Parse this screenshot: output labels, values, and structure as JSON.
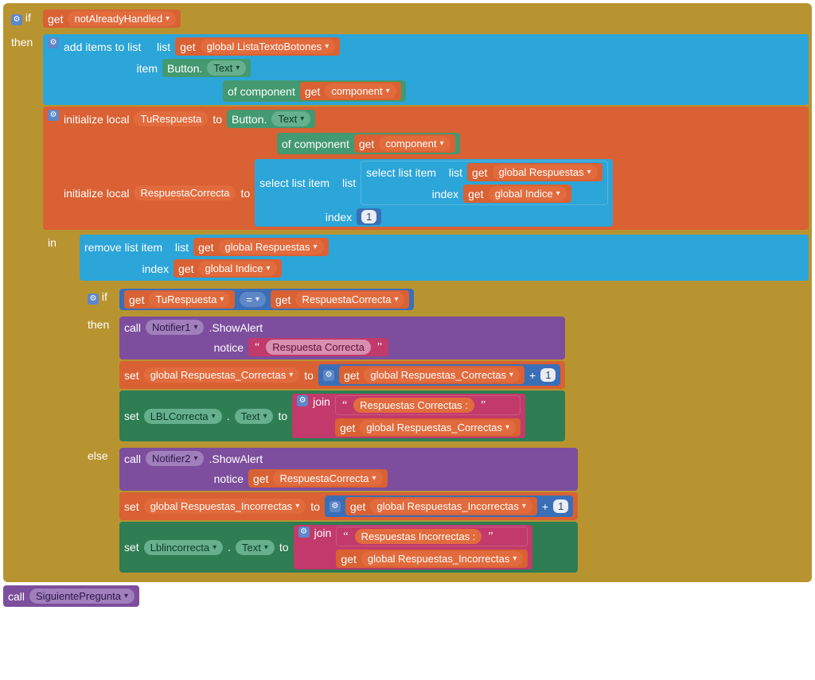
{
  "kw": {
    "if": "if",
    "then": "then",
    "else": "else",
    "in": "in",
    "get": "get",
    "set": "set",
    "to": "to",
    "call": "call",
    "join": "join",
    "addItems": "add items to list",
    "list": "list",
    "item": "item",
    "ofComponent": "of component",
    "initLocal": "initialize local",
    "selectListItem": "select list item",
    "index": "index",
    "removeListItem": "remove list item",
    "button": "Button.",
    "text": "Text",
    "notice": "notice",
    "showAlert": ".ShowAlert",
    "eq": "=",
    "plus": "+"
  },
  "vars": {
    "notAlreadyHandled": "notAlreadyHandled",
    "listaTextoBotones": "global ListaTextoBotones",
    "component": "component",
    "tuRespuesta": "TuRespuesta",
    "respuestaCorrecta": "RespuestaCorrecta",
    "globalRespuestas": "global Respuestas",
    "globalIndice": "global Indice",
    "notifier1": "Notifier1",
    "notifier2": "Notifier2",
    "respuestaCorrectaStr": "Respuesta Correcta",
    "globalRespCorrectas": "global Respuestas_Correctas",
    "lblCorrecta": "LBLCorrecta",
    "respuestasCorrectasLbl": "Respuestas Correctas :",
    "globalRespIncorrectas": "global Respuestas_Incorrectas",
    "lblIncorrecta": "Lblincorrecta",
    "respuestasIncorrectasLbl": "Respuestas Incorrectas :",
    "siguientePregunta": "SiguientePregunta"
  },
  "nums": {
    "one": "1"
  }
}
